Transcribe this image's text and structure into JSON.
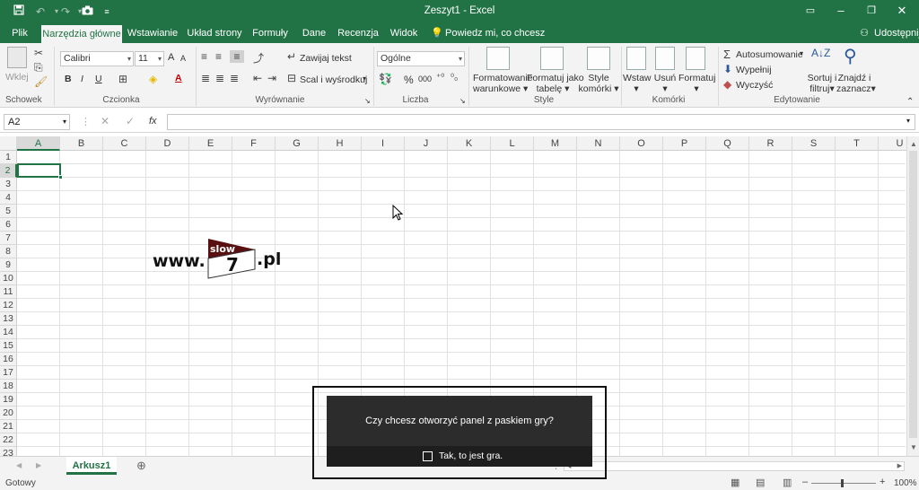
{
  "window": {
    "title": "Zeszyt1 - Excel",
    "colors": {
      "brand": "#217346",
      "ribbon_bg": "#f3f3f3"
    }
  },
  "tabs": {
    "items": [
      {
        "label": "Plik"
      },
      {
        "label": "Narzędzia główne"
      },
      {
        "label": "Wstawianie"
      },
      {
        "label": "Układ strony"
      },
      {
        "label": "Formuły"
      },
      {
        "label": "Dane"
      },
      {
        "label": "Recenzja"
      },
      {
        "label": "Widok"
      }
    ],
    "tell_me": "Powiedz mi, co chcesz zrobić",
    "share": "Udostępnij"
  },
  "ribbon": {
    "clipboard": {
      "paste": "Wklej",
      "group": "Schowek"
    },
    "font": {
      "name": "Calibri",
      "size": "11",
      "bold": "B",
      "italic": "I",
      "underline": "U",
      "grow": "A",
      "shrink": "A",
      "color_a": "A",
      "group": "Czcionka"
    },
    "alignment": {
      "wrap": "Zawijaj tekst",
      "merge": "Scal i wyśrodkuj",
      "group": "Wyrównanie"
    },
    "number": {
      "format": "Ogólne",
      "percent": "%",
      "comma": "000",
      "group": "Liczba"
    },
    "styles": {
      "cond_format_1": "Formatowanie",
      "cond_format_2": "warunkowe",
      "as_table_1": "Formatuj jako",
      "as_table_2": "tabelę",
      "cell_styles_1": "Style",
      "cell_styles_2": "komórki",
      "group": "Style"
    },
    "cells": {
      "insert": "Wstaw",
      "delete": "Usuń",
      "format": "Formatuj",
      "group": "Komórki"
    },
    "editing": {
      "autosum": "Autosumowanie",
      "fill": "Wypełnij",
      "clear": "Wyczyść",
      "sort_1": "Sortuj i",
      "sort_2": "filtruj",
      "find_1": "Znajdź i",
      "find_2": "zaznacz",
      "group": "Edytowanie"
    }
  },
  "formula_bar": {
    "name_box": "A2",
    "fx": "fx",
    "value": ""
  },
  "grid": {
    "columns": [
      "A",
      "B",
      "C",
      "D",
      "E",
      "F",
      "G",
      "H",
      "I",
      "J",
      "K",
      "L",
      "M",
      "N",
      "O",
      "P",
      "Q",
      "R",
      "S",
      "T",
      "U"
    ],
    "rows": [
      "1",
      "2",
      "3",
      "4",
      "5",
      "6",
      "7",
      "8",
      "9",
      "10",
      "11",
      "12",
      "13",
      "14",
      "15",
      "16",
      "17",
      "18",
      "19",
      "20",
      "21",
      "22",
      "23"
    ]
  },
  "logo": {
    "prefix": "www.",
    "top": "slow",
    "number": "7",
    "suffix": ".pl"
  },
  "sheet": {
    "tab": "Arkusz1"
  },
  "status": {
    "ready": "Gotowy",
    "zoom": "100%"
  },
  "game_bar_dialog": {
    "question": "Czy chcesz otworzyć panel z paskiem gry?",
    "checkbox_label": "Tak, to jest gra."
  }
}
